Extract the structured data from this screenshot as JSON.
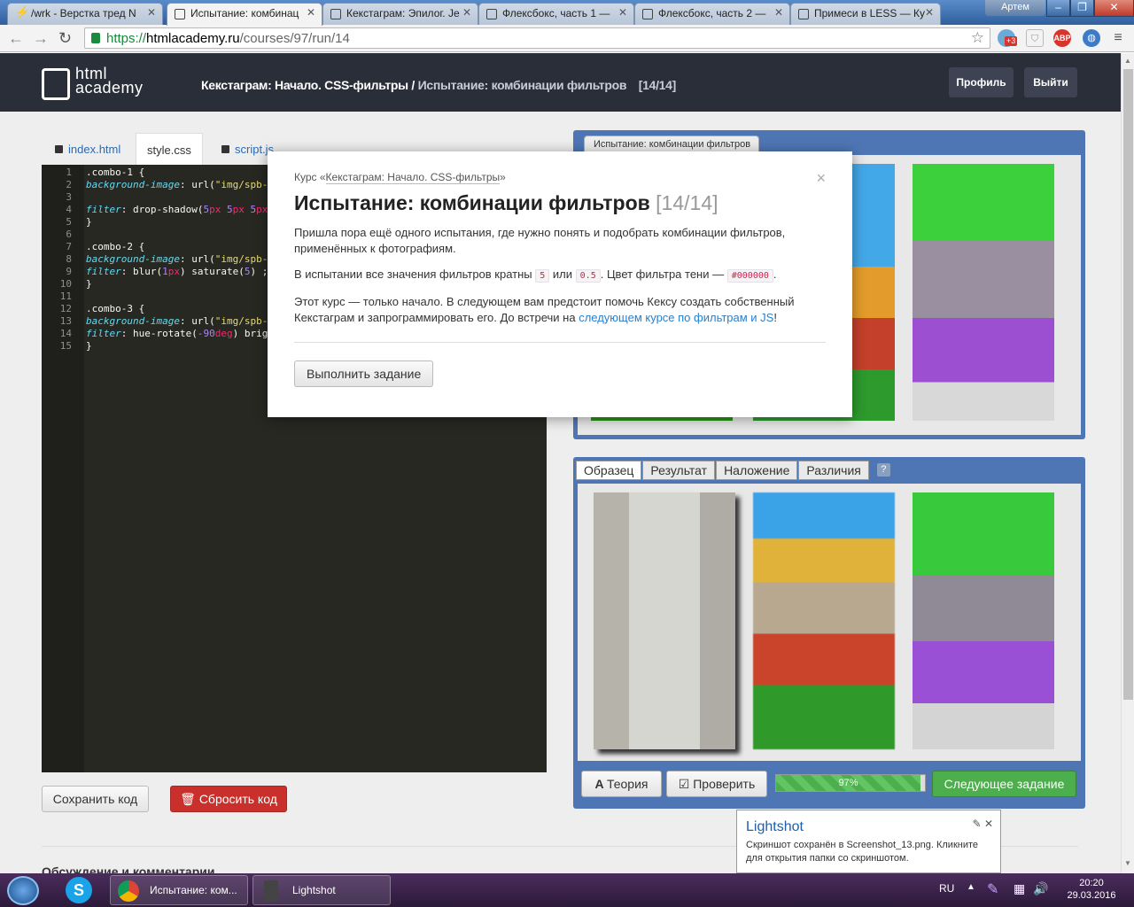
{
  "browser": {
    "tabs": [
      {
        "title": "/wrk - Верстка тред N"
      },
      {
        "title": "Испытание: комбинац"
      },
      {
        "title": "Кекстаграм: Эпилог. Je"
      },
      {
        "title": "Флексбокс, часть 1 —"
      },
      {
        "title": "Флексбокс, часть 2 —"
      },
      {
        "title": "Примеси в LESS — Ку"
      }
    ],
    "user": "Артем",
    "url_scheme": "https://",
    "url_host": "htmlacademy.ru",
    "url_path": "/courses/97/run/14",
    "ext_badge": "+3",
    "abp": "ABP"
  },
  "header": {
    "logo_line1": "html",
    "logo_line2": "academy",
    "crumb_course": "Кекстаграм: Начало. CSS-фильтры /",
    "crumb_current": "Испытание: комбинации фильтров",
    "crumb_count": "[14/14]",
    "profile": "Профиль",
    "logout": "Выйти"
  },
  "editor": {
    "tabs": [
      "index.html",
      "style.css",
      "script.js"
    ],
    "line_numbers": "1\n2\n3\n4\n5\n6\n7\n8\n9\n10\n11\n12\n13\n14\n15",
    "save": "Сохранить код",
    "reset": "Сбросить код"
  },
  "discussion": "Обсуждение и комментарии",
  "preview": {
    "top_tab": "Испытание: комбинации фильтров",
    "tabs": [
      "Образец",
      "Результат",
      "Наложение",
      "Различия"
    ],
    "help": "?",
    "theory": "Теория",
    "check": "Проверить",
    "progress_label": "97%",
    "progress": 0.97,
    "next": "Следующее задание"
  },
  "modal": {
    "course_prefix": "Курс «",
    "course_name": "Кекстаграм: Начало. CSS-фильтры",
    "course_suffix": "»",
    "title": "Испытание: комбинации фильтров",
    "count": "[14/14]",
    "p1": "Пришла пора ещё одного испытания, где нужно понять и подобрать комбинации фильтров, применённых к фотографиям.",
    "p2_a": "В испытании все значения фильтров кратны",
    "code1": "5",
    "p2_b": "или",
    "code2": "0.5",
    "p2_c": ". Цвет фильтра тени —",
    "code3": "#000000",
    "p2_d": ".",
    "p3_a": "Этот курс — только начало. В следующем вам предстоит помочь Кексу создать собственный Кекстаграм и запрограммировать его. До встречи на",
    "p3_link": "следующем курсе по фильтрам и JS",
    "p3_b": "!",
    "close": "×",
    "run": "Выполнить задание"
  },
  "toast": {
    "title": "Lightshot",
    "message": "Скриншот сохранён в Screenshot_13.png. Кликните для открытия папки со скриншотом."
  },
  "taskbar": {
    "chrome_item": "Испытание: ком...",
    "lightshot_item": "Lightshot",
    "lang": "RU",
    "time": "20:20",
    "date": "29.03.2016"
  },
  "colors": {
    "accent": "#4f76b4",
    "header": "#2a2e38",
    "success": "#4cae4c",
    "danger": "#c9302c"
  }
}
